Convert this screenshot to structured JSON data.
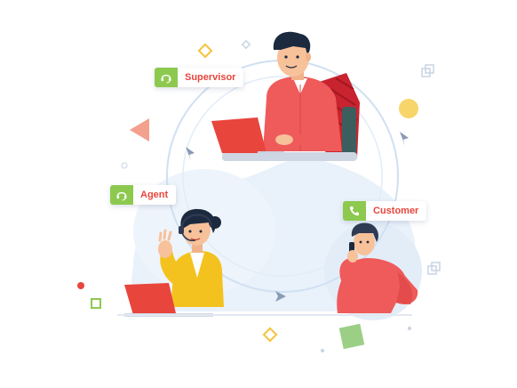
{
  "roles": {
    "supervisor": {
      "label": "Supervisor",
      "icon": "headset-icon"
    },
    "agent": {
      "label": "Agent",
      "icon": "headset-icon"
    },
    "customer": {
      "label": "Customer",
      "icon": "phone-icon"
    }
  },
  "colors": {
    "accent_red": "#e8453c",
    "tag_green": "#8dc94f",
    "agent_yellow": "#f4c21f",
    "ring_blue": "#c9dcef",
    "blob_blue": "#e6eff9"
  }
}
